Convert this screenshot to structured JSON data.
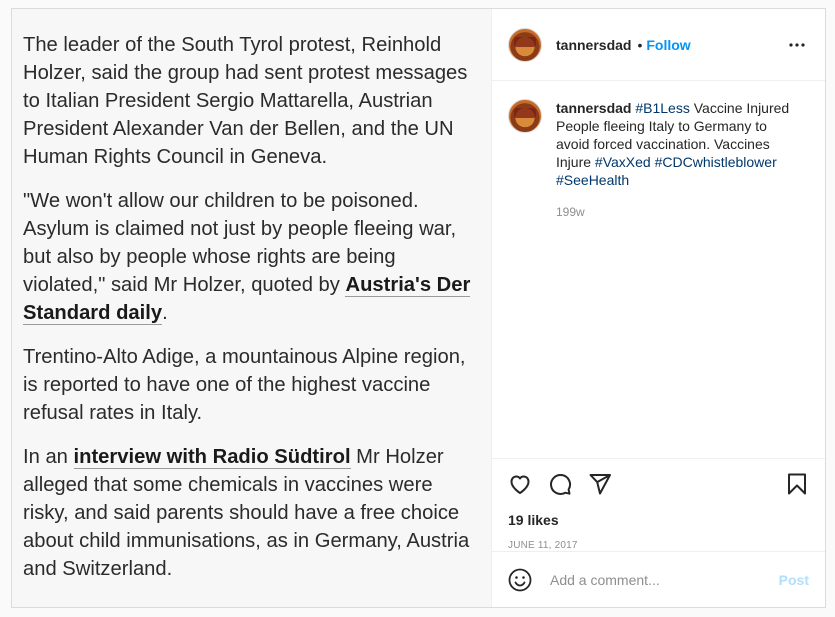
{
  "media": {
    "p1": "The leader of the South Tyrol protest, Reinhold Holzer, said the group had sent protest messages to Italian President Sergio Mattarella, Austrian President Alexander Van der Bellen, and the UN Human Rights Council in Geneva.",
    "p2_before": "\"We won't allow our children to be poisoned. Asylum is claimed not just by people fleeing war, but also by people whose rights are being violated,\" said Mr Holzer, quoted by ",
    "p2_link": "Austria's Der Standard daily",
    "p2_after": ".",
    "p3": "Trentino-Alto Adige, a mountainous Alpine region, is reported to have one of the highest vaccine refusal rates in Italy.",
    "p4_before": "In an ",
    "p4_link": "interview with Radio Südtirol",
    "p4_after": " Mr Holzer alleged that some chemicals in vaccines were risky, and said parents should have a free choice about child immunisations, as in Germany, Austria and Switzerland."
  },
  "header": {
    "username": "tannersdad",
    "separator": "•",
    "follow_label": "Follow"
  },
  "caption": {
    "username": "tannersdad",
    "tag1": "#B1Less",
    "text1": " Vaccine Injured People fleeing Italy to Germany to avoid forced vaccination. Vaccines Injure ",
    "tag2": "#VaxXed",
    "space": " ",
    "tag3": "#CDCwhistleblower",
    "tag4": "#SeeHealth",
    "age": "199w"
  },
  "stats": {
    "likes": "19 likes",
    "date": "JUNE 11, 2017"
  },
  "comment": {
    "placeholder": "Add a comment...",
    "post_label": "Post"
  },
  "icons": {
    "more": "more-options-icon",
    "like": "heart-icon",
    "comment": "comment-bubble-icon",
    "share": "paper-plane-icon",
    "save": "bookmark-icon",
    "emoji": "emoji-smiley-icon"
  },
  "colors": {
    "accent": "#0095f6",
    "hashtag": "#00376b",
    "post_disabled": "#b2dffc"
  }
}
